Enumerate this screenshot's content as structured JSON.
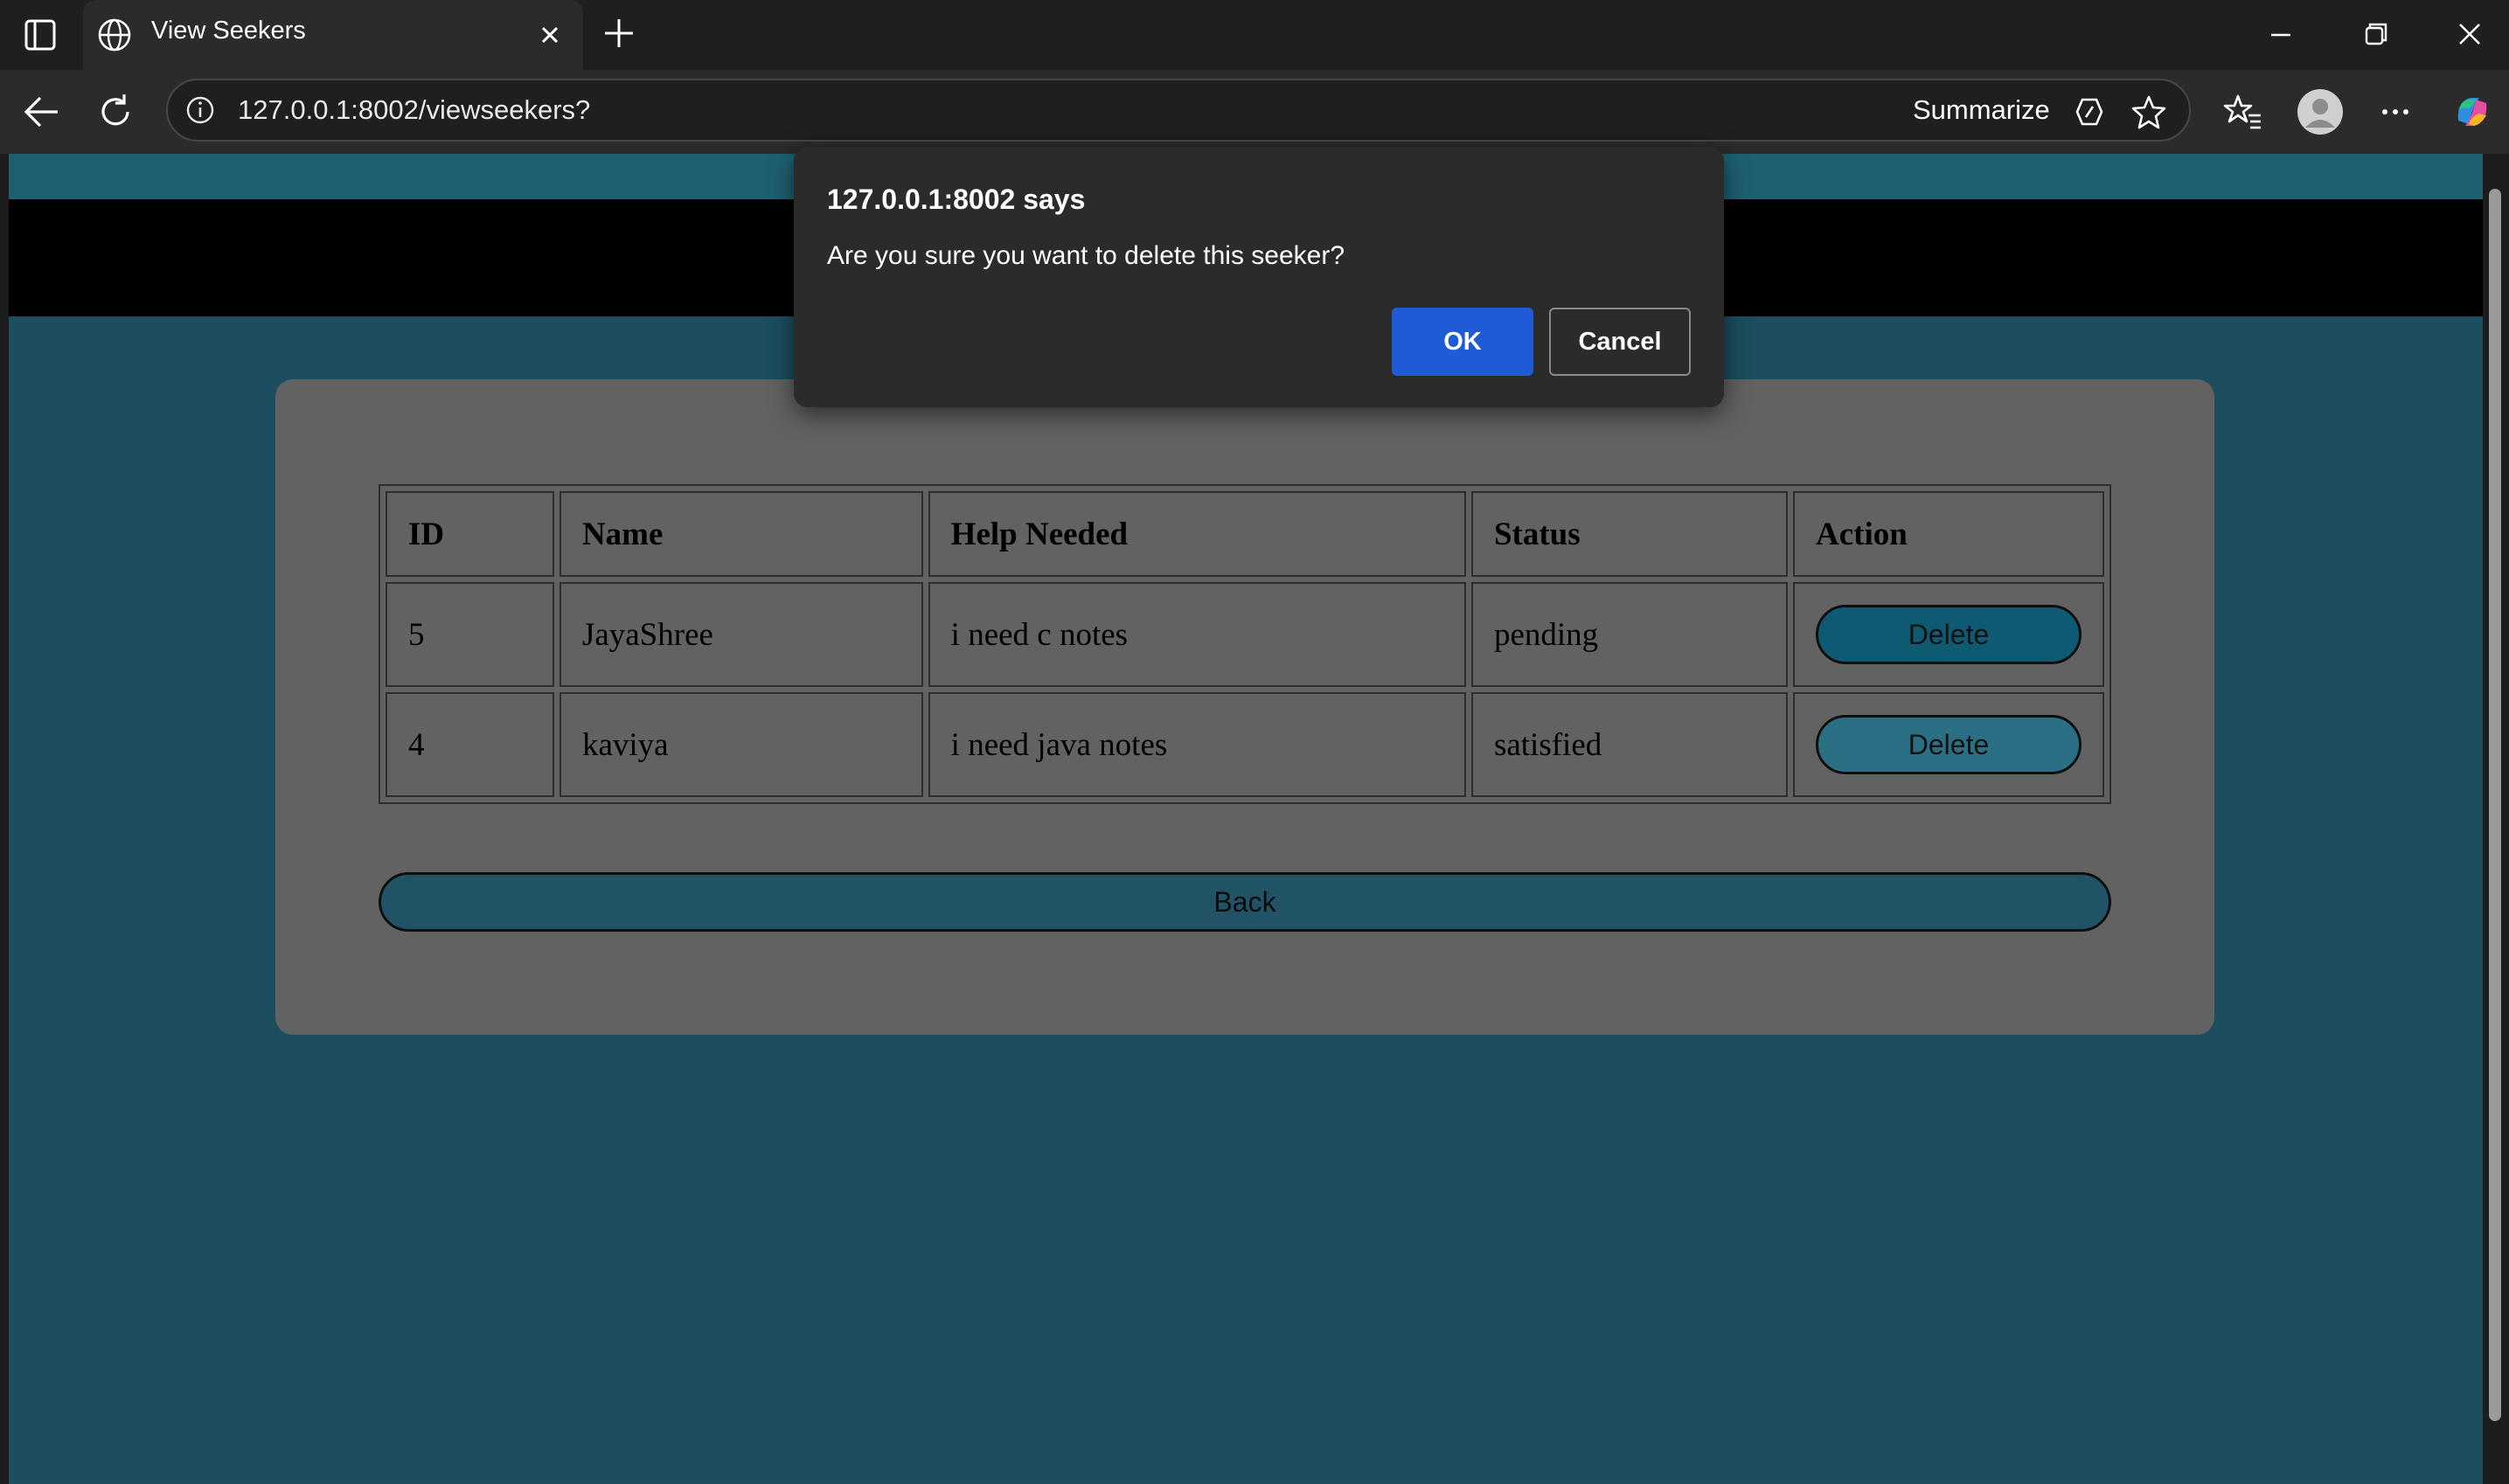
{
  "browser": {
    "tab_title": "View Seekers",
    "url": "127.0.0.1:8002/viewseekers?",
    "summarize_label": "Summarize",
    "icons": [
      "tab-actions-icon",
      "globe-icon",
      "close-icon",
      "plus-icon",
      "minimize-icon",
      "restore-icon",
      "window-close-icon",
      "back-arrow-icon",
      "refresh-icon",
      "info-icon",
      "summarize-icon",
      "star-icon",
      "favorites-icon",
      "profile-icon",
      "more-icon",
      "copilot-icon"
    ]
  },
  "table": {
    "headers": [
      "ID",
      "Name",
      "Help Needed",
      "Status",
      "Action"
    ],
    "rows": [
      {
        "id": "5",
        "name": "JayaShree",
        "help": "i need c notes",
        "status": "pending",
        "action": "Delete"
      },
      {
        "id": "4",
        "name": "kaviya",
        "help": "i need java notes",
        "status": "satisfied",
        "action": "Delete"
      }
    ]
  },
  "back_label": "Back",
  "dialog": {
    "title": "127.0.0.1:8002 says",
    "message": "Are you sure you want to delete this seeker?",
    "ok_label": "OK",
    "cancel_label": "Cancel"
  },
  "colors": {
    "page_bg": "#1c4e5f",
    "card_bg": "#626262",
    "delete_active": "#0e5a72",
    "delete_normal": "#2b6f85",
    "ok_button": "#1f5bd6"
  }
}
